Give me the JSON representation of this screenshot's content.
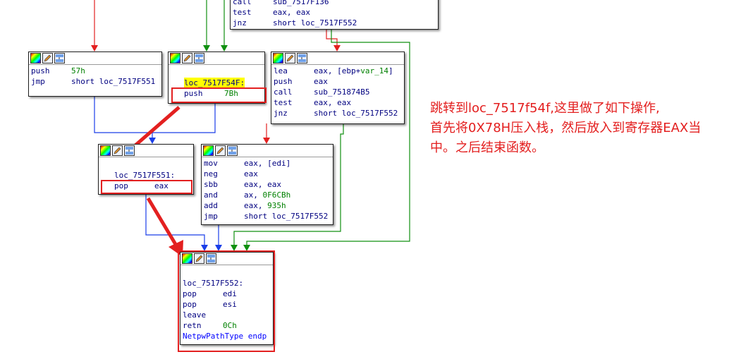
{
  "blocks": {
    "top": {
      "lines": [
        {
          "mn": "call",
          "op": "sub_7517F136"
        },
        {
          "mn": "test",
          "op": "eax, eax"
        },
        {
          "mn": "jnz",
          "op": "short loc_7517F552"
        }
      ]
    },
    "b57": {
      "lines": [
        {
          "mn": "push",
          "num": "57h"
        },
        {
          "mn": "jmp",
          "op": "short loc_7517F551"
        }
      ]
    },
    "b54f": {
      "label": "loc_7517F54F:",
      "lines": [
        {
          "mn": "push",
          "num": "7Bh"
        }
      ]
    },
    "blea": {
      "lines": [
        {
          "mn": "lea",
          "op_a": "eax, [ebp+",
          "var": "var_14",
          "op_b": "]"
        },
        {
          "mn": "push",
          "op": "eax"
        },
        {
          "mn": "call",
          "op": "sub_751874B5"
        },
        {
          "mn": "test",
          "op": "eax, eax"
        },
        {
          "mn": "jnz",
          "op": "short loc_7517F552"
        }
      ]
    },
    "b551": {
      "label": "loc_7517F551:",
      "lines": [
        {
          "mn": "pop",
          "op": "eax"
        }
      ]
    },
    "bmov": {
      "lines": [
        {
          "mn": "mov",
          "op": "eax, [edi]"
        },
        {
          "mn": "neg",
          "op": "eax"
        },
        {
          "mn": "sbb",
          "op": "eax, eax"
        },
        {
          "mn": "and",
          "op_a": "ax, ",
          "num": "0F6CBh"
        },
        {
          "mn": "add",
          "op_a": "eax, ",
          "num": "935h"
        },
        {
          "mn": "jmp",
          "op": "short loc_7517F552"
        }
      ]
    },
    "b552": {
      "label": "loc_7517F552:",
      "lines": [
        {
          "mn": "pop",
          "op": "edi"
        },
        {
          "mn": "pop",
          "op": "esi"
        },
        {
          "mn": "leave",
          "op": ""
        },
        {
          "mn": "retn",
          "num": "0Ch"
        }
      ],
      "endp": "NetpwPathType endp"
    }
  },
  "header_icons": [
    "color-palette-icon",
    "edit-pencil-icon",
    "graph-overview-icon"
  ],
  "annotation": {
    "line1": "跳转到loc_7517f54f,这里做了如下操作,",
    "line2": "首先将0X78H压入栈，然后放入到寄存器EAX当",
    "line3": "中。之后结束函数。"
  },
  "colors": {
    "edge_red": "#e32020",
    "edge_green": "#109010",
    "edge_blue": "#1a3ee8",
    "annotation_red": "#e31e1e",
    "highlight": "#ffff00",
    "code_text": "#000080",
    "numeric": "#008000"
  }
}
